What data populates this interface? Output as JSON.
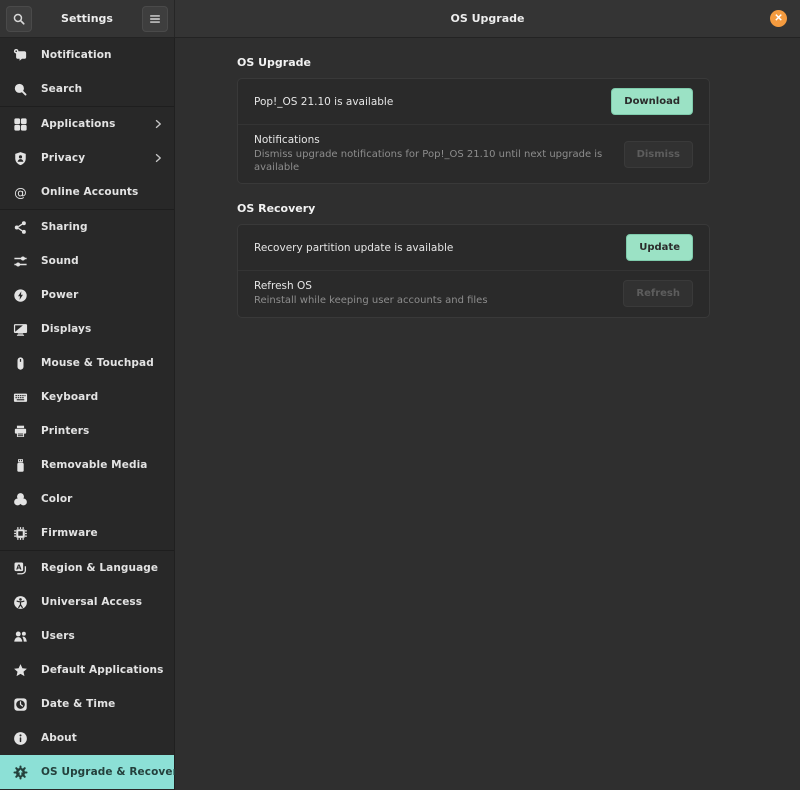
{
  "header": {
    "left_title": "Settings",
    "right_title": "OS Upgrade",
    "search_icon": "search",
    "menu_icon": "hamburger",
    "close_icon": "close",
    "close_glyph": "✕"
  },
  "sidebar": {
    "items": [
      {
        "id": "notification",
        "label": "Notification",
        "icon": "notification"
      },
      {
        "id": "search",
        "label": "Search",
        "icon": "search"
      },
      {
        "id": "applications",
        "label": "Applications",
        "icon": "applications",
        "chevron": true,
        "separator_before": true
      },
      {
        "id": "privacy",
        "label": "Privacy",
        "icon": "privacy",
        "chevron": true
      },
      {
        "id": "online-accounts",
        "label": "Online Accounts",
        "icon": "at"
      },
      {
        "id": "sharing",
        "label": "Sharing",
        "icon": "share",
        "separator_before": true
      },
      {
        "id": "sound",
        "label": "Sound",
        "icon": "sound"
      },
      {
        "id": "power",
        "label": "Power",
        "icon": "power"
      },
      {
        "id": "displays",
        "label": "Displays",
        "icon": "display"
      },
      {
        "id": "mouse-touchpad",
        "label": "Mouse & Touchpad",
        "icon": "mouse"
      },
      {
        "id": "keyboard",
        "label": "Keyboard",
        "icon": "keyboard"
      },
      {
        "id": "printers",
        "label": "Printers",
        "icon": "printer"
      },
      {
        "id": "removable-media",
        "label": "Removable Media",
        "icon": "usb"
      },
      {
        "id": "color",
        "label": "Color",
        "icon": "color"
      },
      {
        "id": "firmware",
        "label": "Firmware",
        "icon": "chip"
      },
      {
        "id": "region-language",
        "label": "Region & Language",
        "icon": "language",
        "separator_before": true
      },
      {
        "id": "universal-access",
        "label": "Universal Access",
        "icon": "access"
      },
      {
        "id": "users",
        "label": "Users",
        "icon": "users"
      },
      {
        "id": "default-applications",
        "label": "Default Applications",
        "icon": "star"
      },
      {
        "id": "date-time",
        "label": "Date & Time",
        "icon": "clock"
      },
      {
        "id": "about",
        "label": "About",
        "icon": "info"
      },
      {
        "id": "os-upgrade-recovery",
        "label": "OS Upgrade & Recovery",
        "icon": "upgrade",
        "selected": true
      }
    ]
  },
  "main": {
    "sections": [
      {
        "title": "OS Upgrade",
        "rows": [
          {
            "title": "Pop!_OS 21.10 is available",
            "button": "Download",
            "button_style": "suggested"
          },
          {
            "title": "Notifications",
            "subtitle": "Dismiss upgrade notifications for Pop!_OS 21.10 until next upgrade is available",
            "button": "Dismiss",
            "button_style": "disabled"
          }
        ]
      },
      {
        "title": "OS Recovery",
        "rows": [
          {
            "title": "Recovery partition update is available",
            "button": "Update",
            "button_style": "suggested"
          },
          {
            "title": "Refresh OS",
            "subtitle": "Reinstall while keeping user accounts and files",
            "button": "Refresh",
            "button_style": "disabled"
          }
        ]
      }
    ]
  },
  "colors": {
    "sidebar_selected": "#8ce0d6",
    "suggested_button": "#9be2c5",
    "close_button": "#f49b3f",
    "header_bg": "#343434",
    "sidebar_bg": "#282828",
    "main_bg": "#2f2f2f",
    "card_bg": "#2a2a2a"
  }
}
